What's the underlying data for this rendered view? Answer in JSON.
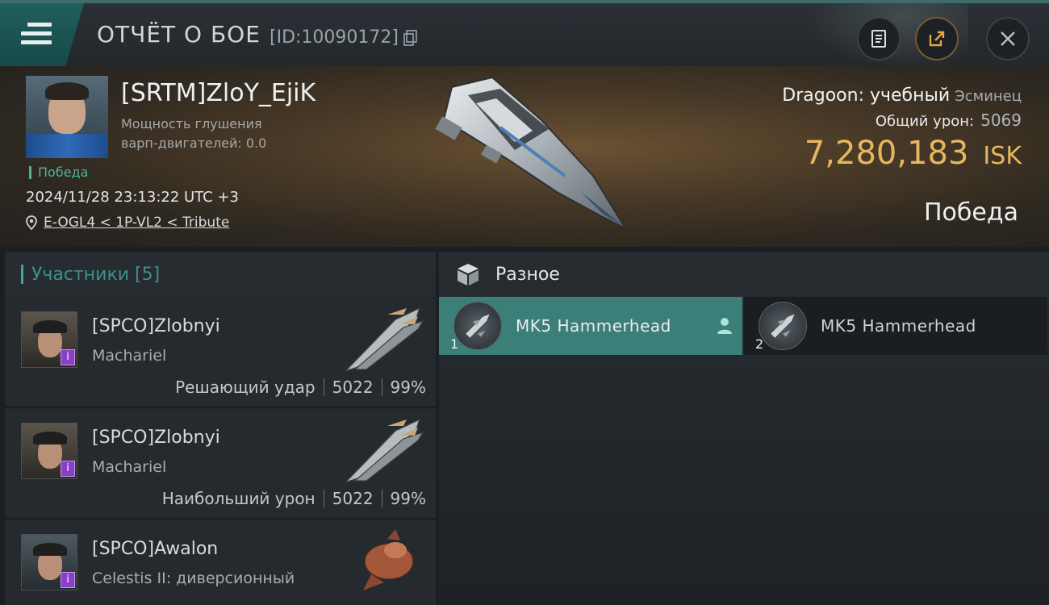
{
  "header": {
    "title": "ОТЧЁТ О БОЕ",
    "report_id": "[ID:10090172]",
    "icons": [
      "menu-icon",
      "copy-icon",
      "notes-icon",
      "share-icon",
      "close-icon"
    ]
  },
  "victim": {
    "name": "[SRTM]ZloY_EjiK",
    "jam_strength_label": "Мощность глушения варп-двигателей: 0.0",
    "status": "Победа",
    "datetime": "2024/11/28 23:13:22 UTC +3",
    "location": "E-OGL4 < 1P-VL2 < Tribute",
    "ship_name": "Dragoon: учебный",
    "ship_class": "Эсминец",
    "total_damage_label": "Общий урон:",
    "total_damage": "5069",
    "isk_value": "7,280,183",
    "isk_currency": "ISK",
    "result": "Победа"
  },
  "participants": {
    "label": "Участники [5]",
    "rows": [
      {
        "name": "[SPCO]Zlobnyi",
        "ship": "Machariel",
        "role": "Решающий удар",
        "damage": "5022",
        "percent": "99%",
        "badge": "i"
      },
      {
        "name": "[SPCO]Zlobnyi",
        "ship": "Machariel",
        "role": "Наибольший урон",
        "damage": "5022",
        "percent": "99%",
        "badge": "i"
      },
      {
        "name": "[SPCO]Awalon",
        "ship": "Celestis II: диверсионный",
        "badge": "i"
      }
    ]
  },
  "misc": {
    "label": "Разное",
    "items": [
      {
        "name": "MK5  Hammerhead",
        "count": "1",
        "selected": true
      },
      {
        "name": "MK5  Hammerhead",
        "count": "2",
        "selected": false
      }
    ]
  },
  "colors": {
    "accent_teal": "#3c7f78",
    "isk_gold": "#e6b85d",
    "victory_green": "#4fb39a",
    "badge_purple": "#8a3fc8"
  }
}
